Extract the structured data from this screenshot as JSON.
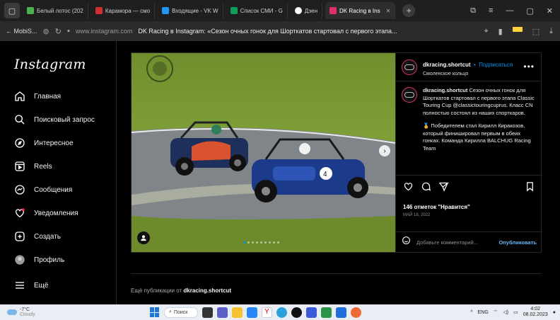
{
  "browser": {
    "tabs": [
      {
        "label": "Белый лотос (202",
        "color": "#4caf50",
        "active": false
      },
      {
        "label": "Карамора — смо",
        "color": "#d32f2f",
        "active": false
      },
      {
        "label": "Входящие - VK W",
        "color": "#2196f3",
        "active": false
      },
      {
        "label": "Список СМИ - G",
        "color": "#0f9d58",
        "active": false
      },
      {
        "label": "Дзен",
        "color": "#222222",
        "active": false
      },
      {
        "label": "DK Racing в Ins",
        "color": "#e1306c",
        "active": true
      }
    ],
    "new_tab": "+",
    "back_label": "← MobiS...",
    "url": "www.instagram.com",
    "page_title": "DK Racing в Instagram: «Сезон очных гонок для Шорткатов стартовал с первого этапа..."
  },
  "sidebar": {
    "logo": "Instagram",
    "items": [
      {
        "label": "Главная",
        "icon": "home-icon"
      },
      {
        "label": "Поисковый запрос",
        "icon": "search-icon"
      },
      {
        "label": "Интересное",
        "icon": "compass-icon"
      },
      {
        "label": "Reels",
        "icon": "reels-icon"
      },
      {
        "label": "Сообщения",
        "icon": "messenger-icon"
      },
      {
        "label": "Уведомления",
        "icon": "heart-icon"
      },
      {
        "label": "Создать",
        "icon": "create-icon"
      },
      {
        "label": "Профиль",
        "icon": "profile-avatar-icon"
      },
      {
        "label": "Ещё",
        "icon": "menu-icon"
      }
    ]
  },
  "post": {
    "username": "dkracing.shortcut",
    "follow_label": "Подписаться",
    "separator": "•",
    "location": "Смоленское кольцо",
    "caption_user": "dkracing.shortcut",
    "caption_p1": "Сезон очных гонок для Шорткатов стартовал с первого этапа Classic Touring Cup @classictouringcuprus. Класс CN полностью состоял из наших спорткаров.",
    "caption_p2": "🏅 Победителем стал Кирилл Киракозов, который финишировал первым в обеих гонках. Команда Кирилла BALCHUG Racing Team",
    "likes": "146 отметок \"Нравится\"",
    "date": "МАЙ 18, 2022",
    "comment_placeholder": "Добавьте комментарий...",
    "publish_label": "Опубликовать",
    "more_from_prefix": "Ещё публикации от",
    "more_from_user": "dkracing.shortcut"
  },
  "taskbar": {
    "temperature": "-7°C",
    "weather_text": "Cloudy",
    "search_label": "Поиск",
    "lang": "ENG",
    "time": "4:02",
    "date": "08.02.2023"
  },
  "colors": {
    "accent": "#0095f6",
    "background": "#000000",
    "border": "#262626"
  }
}
